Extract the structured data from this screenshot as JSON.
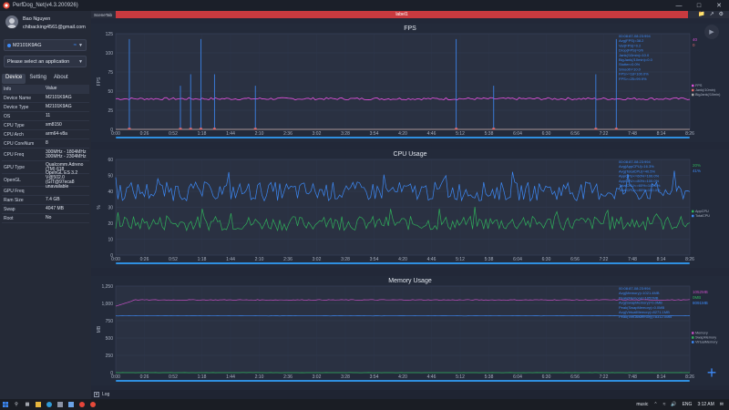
{
  "window": {
    "title": "PerfDog_Net(v4.3.200926)"
  },
  "profile": {
    "name": "Bao Nguyen",
    "email": "chibacking4561@gmail.com"
  },
  "device_select": {
    "value": "M2101K9AG"
  },
  "app_select": {
    "placeholder": "Please select an application"
  },
  "tabs": [
    "Device",
    "Setting",
    "About"
  ],
  "info": {
    "header": {
      "k": "Info",
      "v": "Value"
    },
    "rows": [
      {
        "k": "Device Name",
        "v": "M2101K9AG"
      },
      {
        "k": "Device Type",
        "v": "M2101K9AG"
      },
      {
        "k": "OS",
        "v": "11"
      },
      {
        "k": "CPU Type",
        "v": "sm8150"
      },
      {
        "k": "CPU Arch",
        "v": "arm64-v8a"
      },
      {
        "k": "CPU CoreNum",
        "v": "8"
      },
      {
        "k": "CPU Freq",
        "v": "300MHz - 1804MHz 300MHz - 2304MHz"
      },
      {
        "k": "GPU Type",
        "v": "Qualcomm Adreno (TM) 618"
      },
      {
        "k": "OpenGL",
        "v": "OpenGL ES 3.2 V@502.0 (GIT@97eca8 unavailable"
      },
      {
        "k": "GPU Freq",
        "v": ""
      },
      {
        "k": "Ram Size",
        "v": "7.4 GB"
      },
      {
        "k": "Swap",
        "v": "4047 MB"
      },
      {
        "k": "Root",
        "v": "No"
      }
    ]
  },
  "main": {
    "scene_tab": "SceneTab",
    "label_bar": "label1",
    "log_label": "Log"
  },
  "taskbar": {
    "music": "music",
    "lang": "ENG",
    "time": "3:12 AM"
  },
  "colors": {
    "accent": "#3d8af7",
    "fps_line": "#d94fd6",
    "cpu_app": "#3d8af7",
    "cpu_total": "#2fb05a",
    "mem": "#c04fbf",
    "swap": "#2fb05a",
    "virtual": "#3d8af7",
    "label_bar": "#c93a3f"
  },
  "chart_data": [
    {
      "type": "line",
      "title": "FPS",
      "ylabel": "FPS",
      "ylim": [
        0,
        125
      ],
      "yticks": [
        0,
        25,
        50,
        75,
        100,
        125
      ],
      "xticks": [
        "0:00",
        "0:26",
        "0:52",
        "1:18",
        "1:44",
        "2:10",
        "2:36",
        "3:02",
        "3:28",
        "3:54",
        "4:20",
        "4:46",
        "5:12",
        "5:38",
        "6:04",
        "6:30",
        "6:56",
        "7:22",
        "7:48",
        "8:14",
        "8:26"
      ],
      "series": [
        {
          "name": "FPS",
          "color": "#d94fd6",
          "base": 40
        },
        {
          "name": "Jank(/10min)",
          "color": "#e06a6a",
          "base": 0
        },
        {
          "name": "BigJank(/10min)",
          "color": "#aaaaaa",
          "base": 0
        }
      ],
      "spikes_minutes": [
        0.2,
        0.95,
        1.1,
        1.25,
        1.45,
        2.05,
        5.0,
        5.55,
        7.05,
        7.35
      ],
      "stats_text": [
        "00:08:87-08:23:994",
        "Avg(FPS)=38.2",
        "Var(FPS)=0.2",
        "Drop(FPS)=0/h",
        "Jank(/10min)=10.0",
        "BigJank(/10min)=0.0",
        "Stutter=0.0%",
        "Smooth=10.0",
        "FPS>=18=100.0%",
        "FPS>=25=99.9%"
      ],
      "readout": [
        "40",
        "0"
      ]
    },
    {
      "type": "line",
      "title": "CPU Usage",
      "ylabel": "%",
      "ylim": [
        0,
        60
      ],
      "yticks": [
        0,
        10,
        20,
        30,
        40,
        50,
        60
      ],
      "xticks": [
        "0:00",
        "0:26",
        "0:52",
        "1:18",
        "1:44",
        "2:10",
        "2:36",
        "3:02",
        "3:28",
        "3:54",
        "4:20",
        "4:46",
        "5:12",
        "5:38",
        "6:04",
        "6:30",
        "6:56",
        "7:22",
        "7:48",
        "8:14",
        "8:26"
      ],
      "series": [
        {
          "name": "AppCPU",
          "color": "#2fb05a",
          "base": 20
        },
        {
          "name": "TotalCPU",
          "color": "#3d8af7",
          "base": 40
        }
      ],
      "stats_text": [
        "00:08:87-08:23:994",
        "Avg(AppCPU)=16.3%",
        "Avg(TotalCPU)=40.5%",
        "AppCPU<=60%=100.0%",
        "AppCPU<=80%=100.0%",
        "TotalCPU<=60%=100.0%",
        "TotalCPU<=80%=100.0%"
      ],
      "readout": [
        "20%",
        "41%"
      ]
    },
    {
      "type": "line",
      "title": "Memory Usage",
      "ylabel": "MB",
      "ylim": [
        0,
        1250
      ],
      "yticks": [
        0,
        250,
        500,
        750,
        1000,
        1250
      ],
      "xticks": [
        "0:00",
        "0:26",
        "0:52",
        "1:18",
        "1:44",
        "2:10",
        "2:36",
        "3:02",
        "3:28",
        "3:54",
        "4:20",
        "4:46",
        "5:12",
        "5:38",
        "6:04",
        "6:30",
        "6:56",
        "7:22",
        "7:48",
        "8:14",
        "8:26"
      ],
      "series": [
        {
          "name": "Memory",
          "color": "#c04fbf",
          "base": 1050
        },
        {
          "name": "SwapMemory",
          "color": "#2fb05a",
          "base": 0
        },
        {
          "name": "VirtualMemory",
          "color": "#3d8af7",
          "base": 820
        }
      ],
      "stats_text": [
        "00:08:87-08:23:994",
        "Avg(Memory)=1021.4MB",
        "Peak(Memory)=1052MB",
        "Avg(SwapMemory)=0.0MB",
        "Peak(SwapMemory)=0.0MB",
        "Avg(VirtualMemory)=8271.1MB",
        "Peak(VirtualMemory)=8312.0MB"
      ],
      "readout": [
        "1052MB",
        "0MB",
        "8091MB"
      ]
    }
  ]
}
